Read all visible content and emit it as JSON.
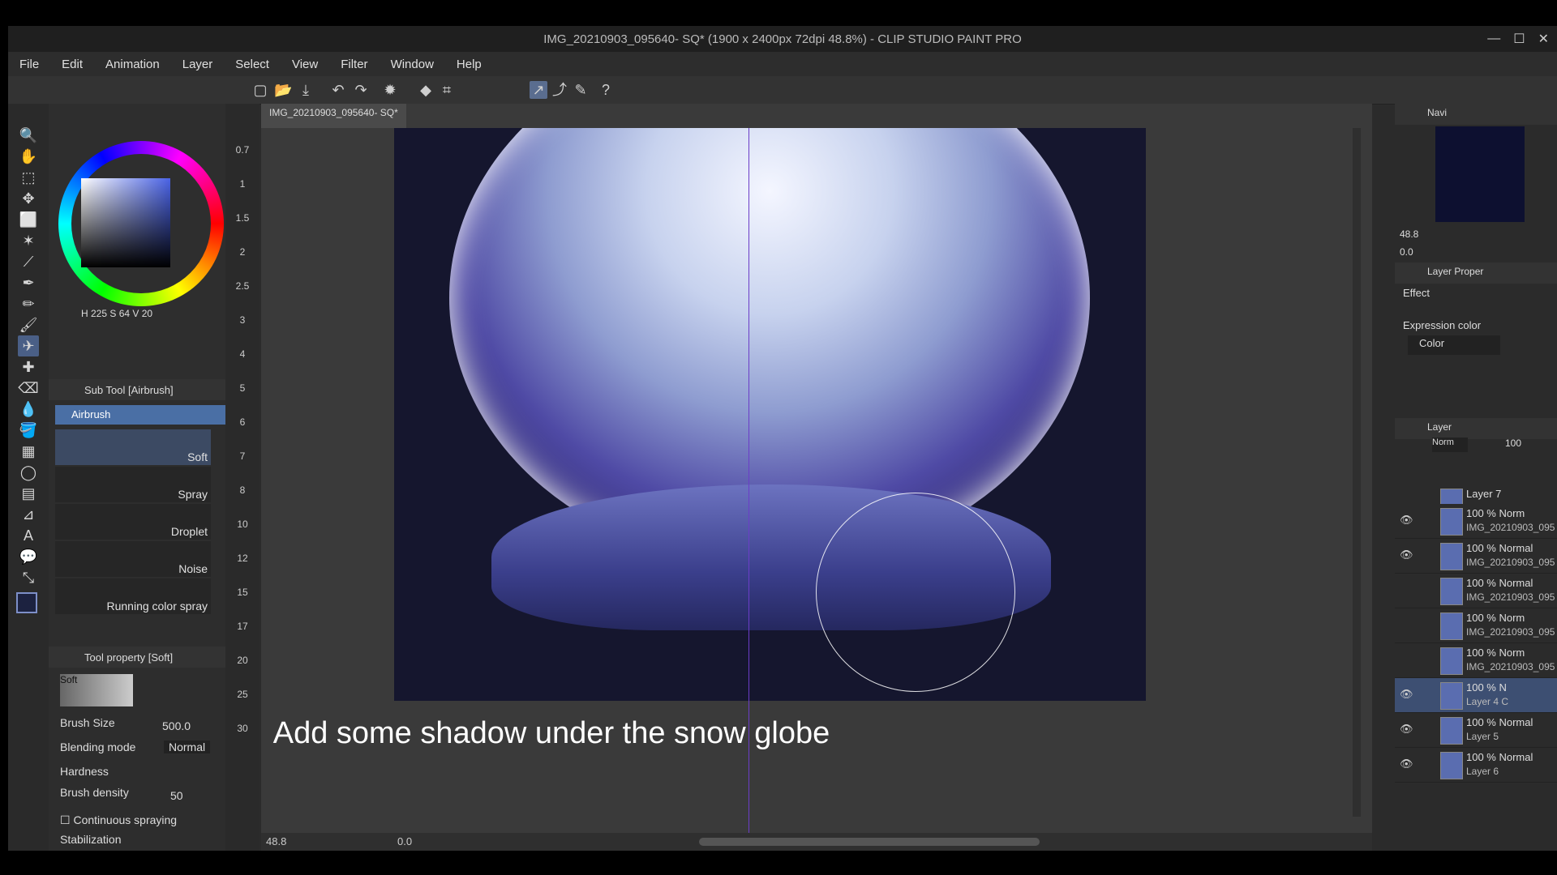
{
  "window": {
    "title": "IMG_20210903_095640- SQ* (1900 x 2400px 72dpi 48.8%)  - CLIP STUDIO PAINT PRO",
    "controls": [
      "—",
      "☐",
      "✕"
    ]
  },
  "menu": [
    "File",
    "Edit",
    "Animation",
    "Layer",
    "Select",
    "View",
    "Filter",
    "Window",
    "Help"
  ],
  "color": {
    "h": "225",
    "s": "64",
    "v": "20"
  },
  "subtool": {
    "header": "Sub Tool [Airbrush]",
    "group": "Airbrush",
    "brushes": [
      "Soft",
      "Spray",
      "Droplet",
      "Noise",
      "Running color spray"
    ],
    "selected": "Soft"
  },
  "toolprop": {
    "header": "Tool property [Soft]",
    "preset": "Soft",
    "brush_size_label": "Brush Size",
    "brush_size": "500.0",
    "blend_label": "Blending mode",
    "blend_value": "Normal",
    "hardness_label": "Hardness",
    "density_label": "Brush density",
    "density": "50",
    "continuous_label": "Continuous spraying",
    "stabilization_label": "Stabilization"
  },
  "sizes": [
    "0.7",
    "1",
    "1.5",
    "2",
    "2.5",
    "3",
    "4",
    "5",
    "6",
    "7",
    "8",
    "10",
    "12",
    "15",
    "17",
    "20",
    "25",
    "30"
  ],
  "document_tab": "IMG_20210903_095640- SQ*",
  "status": {
    "zoom": "48.8",
    "rotate": "0.0"
  },
  "caption": "Add some shadow under the snow globe",
  "navigator": {
    "label": "Navi",
    "zoom": "48.8",
    "rotate": "0.0"
  },
  "layer_property": {
    "label": "Layer Proper",
    "effect_label": "Effect",
    "expression_label": "Expression color",
    "expression_value": "Color"
  },
  "layer_panel": {
    "label": "Layer",
    "blend": "Norm",
    "opacity": "100"
  },
  "layers": [
    {
      "line1": "Layer 7",
      "line2": ""
    },
    {
      "line1": "100 % Norm",
      "line2": "IMG_20210903_095"
    },
    {
      "line1": "100 % Normal",
      "line2": "IMG_20210903_095"
    },
    {
      "line1": "100 % Normal",
      "line2": "IMG_20210903_095"
    },
    {
      "line1": "100 % Norm",
      "line2": "IMG_20210903_095"
    },
    {
      "line1": "100 % Norm",
      "line2": "IMG_20210903_095"
    },
    {
      "line1": "100 % N",
      "line2": "Layer 4 C"
    },
    {
      "line1": "100 % Normal",
      "line2": "Layer 5"
    },
    {
      "line1": "100 % Normal",
      "line2": "Layer 6"
    }
  ]
}
